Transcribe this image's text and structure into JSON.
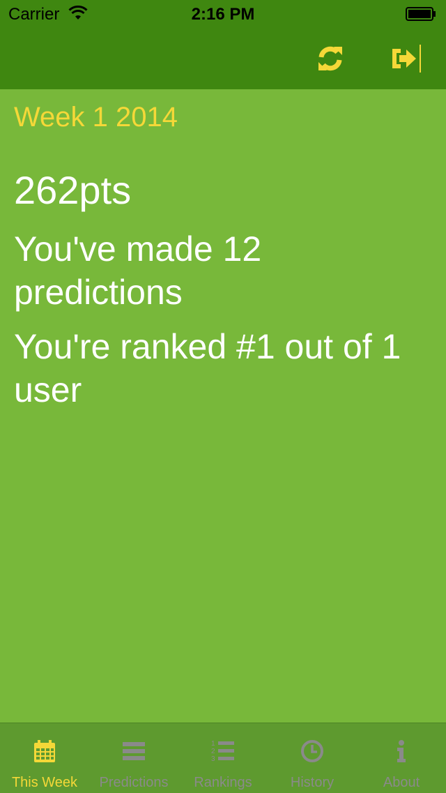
{
  "status_bar": {
    "carrier": "Carrier",
    "time": "2:16 PM"
  },
  "nav": {
    "refresh_icon": "refresh-icon",
    "logout_icon": "sign-out-icon"
  },
  "main": {
    "week_title": "Week 1 2014",
    "points": "262pts",
    "predictions_text": "You've made 12 predictions",
    "ranking_text": "You're ranked #1 out of 1 user"
  },
  "tabs": [
    {
      "label": "This Week",
      "icon": "calendar-icon",
      "active": true
    },
    {
      "label": "Predictions",
      "icon": "list-icon",
      "active": false
    },
    {
      "label": "Rankings",
      "icon": "ordered-list-icon",
      "active": false
    },
    {
      "label": "History",
      "icon": "clock-icon",
      "active": false
    },
    {
      "label": "About",
      "icon": "info-icon",
      "active": false
    }
  ],
  "colors": {
    "bar_green": "#3f8710",
    "content_green": "#78b83a",
    "tab_bar_green": "#5e9a2f",
    "accent_yellow": "#f5d838",
    "inactive_gray": "#8a8a8a"
  }
}
